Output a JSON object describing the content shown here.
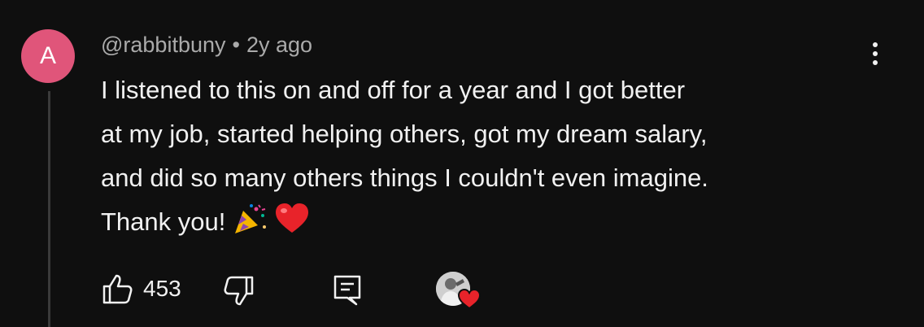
{
  "comment": {
    "avatar_letter": "A",
    "avatar_color": "#e0557a",
    "author": "@rabbitbuny",
    "separator": "•",
    "time": "2y ago",
    "text": "I listened to this on and off for a year and I got better\nat my job, started helping others, got my dream salary,\nand did so many others things I couldn't even imagine.\nThank you!",
    "emojis": [
      "party-popper-icon",
      "red-heart-icon"
    ]
  },
  "actions": {
    "like_count": "453",
    "icons": [
      "thumbs-up-icon",
      "thumbs-down-icon",
      "reply-icon",
      "creator-heart-icon"
    ]
  },
  "colors": {
    "background": "#0f0f0f",
    "text": "#f1f1f1",
    "muted": "#aaaaaa",
    "heart": "#e8232a"
  }
}
